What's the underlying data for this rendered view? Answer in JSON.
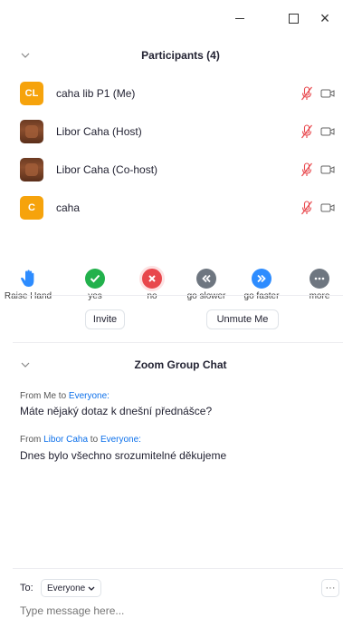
{
  "window": {
    "minimize_icon": "minimize-icon",
    "maximize_icon": "maximize-icon",
    "close_label": "×"
  },
  "participants": {
    "header": "Participants (4)",
    "list": [
      {
        "initials": "CL",
        "name": "caha lib P1 (Me)",
        "avatar": "initials",
        "color": "#f6a30c"
      },
      {
        "initials": "",
        "name": "Libor Caha (Host)",
        "avatar": "photo",
        "color": "#7a3f24"
      },
      {
        "initials": "",
        "name": "Libor Caha (Co-host)",
        "avatar": "photo",
        "color": "#7a3f24"
      },
      {
        "initials": "C",
        "name": "caha",
        "avatar": "initials",
        "color": "#f6a30c"
      }
    ],
    "muted_color": "#e8474c"
  },
  "reactions": [
    {
      "label": "Raise Hand",
      "icon": "raise-hand-icon",
      "color": "#2d8cff"
    },
    {
      "label": "yes",
      "icon": "check-icon",
      "color": "#22b14c"
    },
    {
      "label": "no",
      "icon": "cross-icon",
      "color": "#e8474c"
    },
    {
      "label": "go slower",
      "icon": "rewind-icon",
      "color": "#6e7680"
    },
    {
      "label": "go faster",
      "icon": "fast-forward-icon",
      "color": "#2d8cff"
    },
    {
      "label": "more",
      "icon": "more-icon",
      "color": "#6e7680"
    }
  ],
  "actions": {
    "invite": "Invite",
    "unmute": "Unmute Me"
  },
  "chat": {
    "header": "Zoom Group Chat",
    "messages": [
      {
        "from_prefix": "From ",
        "sender": "Me",
        "to_text": " to ",
        "recipient": "Everyone:",
        "text": "Máte nějaký dotaz k dnešní přednášce?"
      },
      {
        "from_prefix": "From ",
        "sender": "Libor Caha",
        "to_text": " to ",
        "recipient": "Everyone:",
        "text": "Dnes bylo všechno srozumitelné děkujeme"
      }
    ],
    "to_label": "To:",
    "to_value": "Everyone",
    "more_label": "···",
    "placeholder": "Type message here..."
  }
}
